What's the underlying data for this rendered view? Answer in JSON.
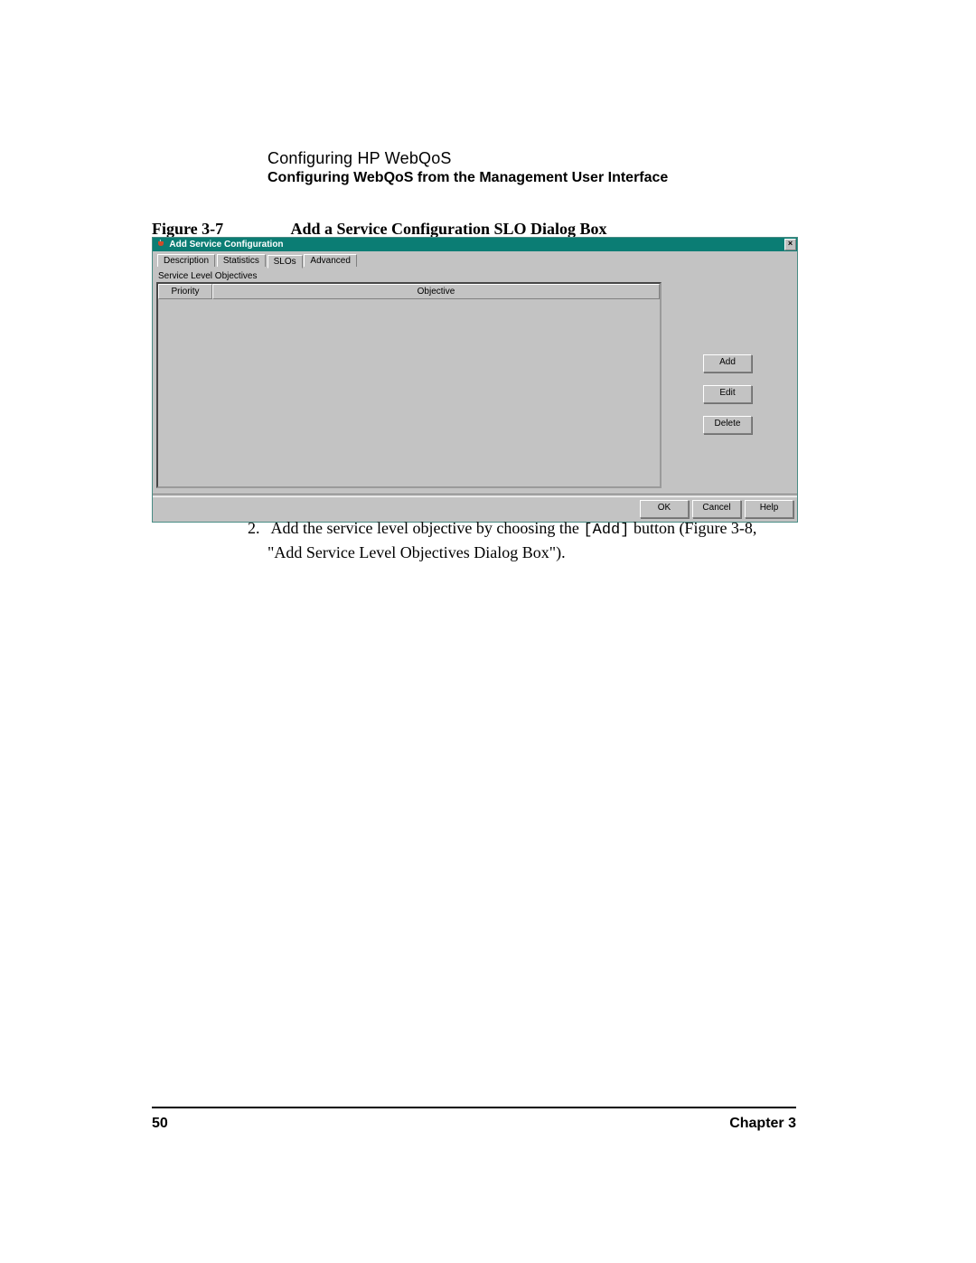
{
  "header": {
    "line1": "Configuring HP WebQoS",
    "line2": "Configuring WebQoS from the Management User Interface"
  },
  "figure": {
    "label": "Figure 3-7",
    "title": "Add a Service Configuration SLO Dialog Box"
  },
  "dialog": {
    "title": "Add Service Configuration",
    "tabs": [
      "Description",
      "Statistics",
      "SLOs",
      "Advanced"
    ],
    "active_tab_index": 2,
    "panel_label": "Service Level Objectives",
    "columns": {
      "priority": "Priority",
      "objective": "Objective"
    },
    "side_buttons": {
      "add": "Add",
      "edit": "Edit",
      "delete": "Delete"
    },
    "bottom_buttons": {
      "ok": "OK",
      "cancel": "Cancel",
      "help": "Help"
    },
    "close_glyph": "×"
  },
  "body": {
    "step_number": "2.",
    "text_before_mono": "Add the service level objective by choosing the ",
    "mono": "[Add]",
    "text_after_mono": " button (Figure 3-8, \"Add Service Level Objectives Dialog Box\")."
  },
  "footer": {
    "page_number": "50",
    "chapter": "Chapter 3"
  }
}
